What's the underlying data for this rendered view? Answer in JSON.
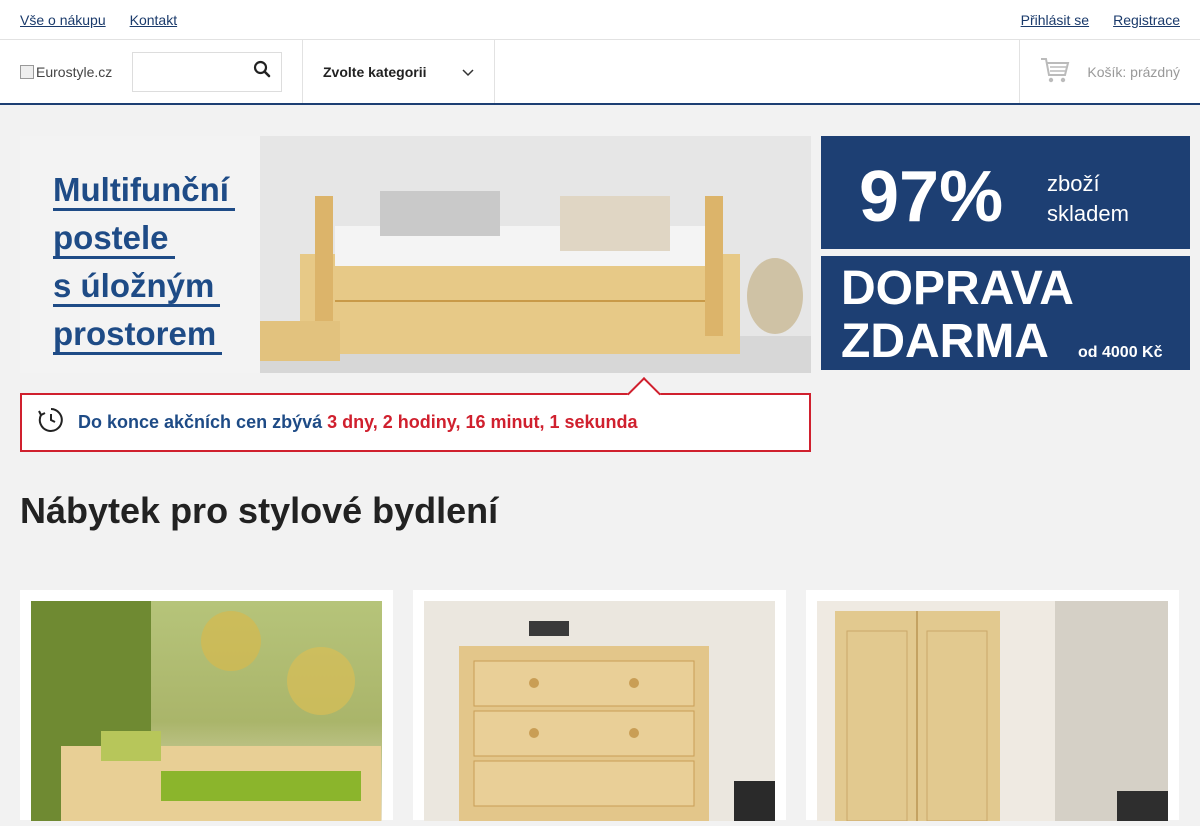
{
  "topbar": {
    "links_left": [
      "Vše o nákupu",
      "Kontakt"
    ],
    "login": "Přihlásit se",
    "register": "Registrace"
  },
  "header": {
    "logo_alt": "Eurostyle.cz",
    "search_placeholder": "",
    "category_select": "Zvolte kategorii",
    "cart_text": "Košík: prázdný"
  },
  "hero": {
    "lines": [
      "Multifunční",
      "postele",
      "s úložným",
      "prostorem"
    ]
  },
  "promos": {
    "stock_percent": "97%",
    "stock_line1": "zboží",
    "stock_line2": "skladem",
    "shipping_line1": "DOPRAVA",
    "shipping_line2": "ZDARMA",
    "shipping_note": "od 4000 Kč"
  },
  "countdown": {
    "label": "Do konce akčních cen zbývá",
    "time": "3 dny, 2 hodiny, 16 minut, 1 sekunda"
  },
  "main": {
    "title": "Nábytek pro stylové bydlení"
  },
  "colors": {
    "brand_blue": "#1d3f73",
    "accent_red": "#d0202e"
  }
}
